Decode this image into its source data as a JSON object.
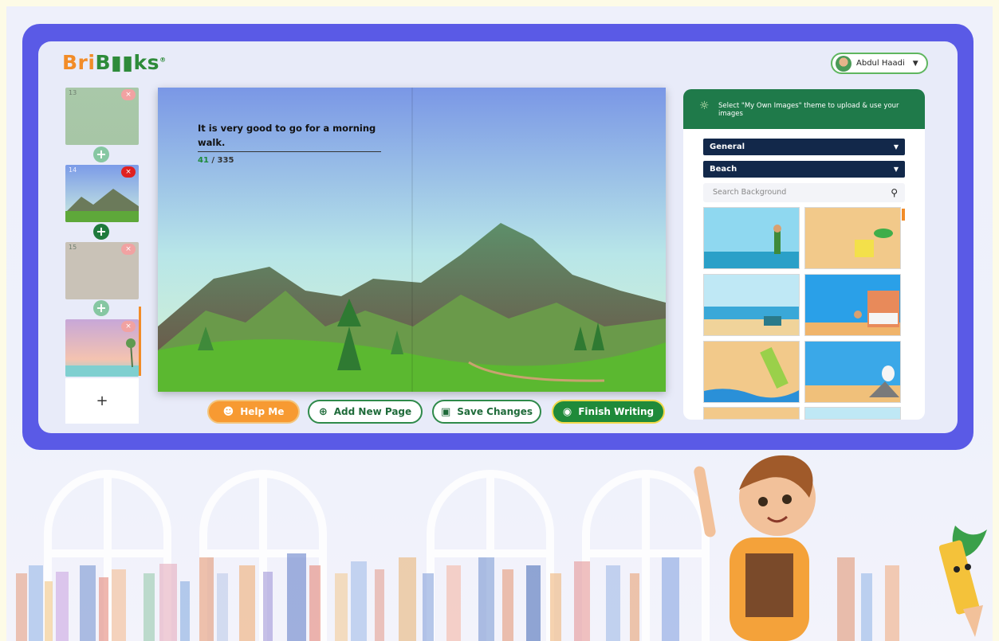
{
  "brand": {
    "logo_part1": "Bri",
    "logo_part2": "B",
    "logo_part3": "ks",
    "registered": "®"
  },
  "user": {
    "name": "Abdul Haadi"
  },
  "thumbnails": [
    {
      "number": "13",
      "delete_label": "×",
      "state": "dim"
    },
    {
      "number": "14",
      "delete_label": "×",
      "state": "active"
    },
    {
      "number": "15",
      "delete_label": "×",
      "state": "dim"
    },
    {
      "number": "",
      "delete_label": "×",
      "state": "dim"
    }
  ],
  "add_page_symbol": "+",
  "new_page_symbol": "+",
  "story": {
    "text": "It is very good to go for a morning walk.",
    "count_used": "41",
    "count_sep": " / ",
    "count_max": "335"
  },
  "actions": {
    "help": "Help Me",
    "add_page": "Add New Page",
    "save": "Save Changes",
    "finish": "Finish Writing"
  },
  "panel": {
    "hint": "Select \"My Own Images\" theme to upload & use your images",
    "category": "General",
    "theme": "Beach",
    "search_placeholder": "Search Background"
  },
  "colors": {
    "frame": "#5a5ae6",
    "brand_orange": "#f28c28",
    "brand_green": "#2e8b3a",
    "panel_header": "#1f7a4a",
    "select_bg": "#12284a",
    "finish_bg": "#1f8a3a",
    "help_bg": "#f79a32"
  },
  "icons": {
    "help": "robot-icon",
    "add_page": "plus-circle-icon",
    "save": "floppy-icon",
    "finish": "eye-icon",
    "hint": "lightbulb-icon",
    "search": "search-icon"
  }
}
